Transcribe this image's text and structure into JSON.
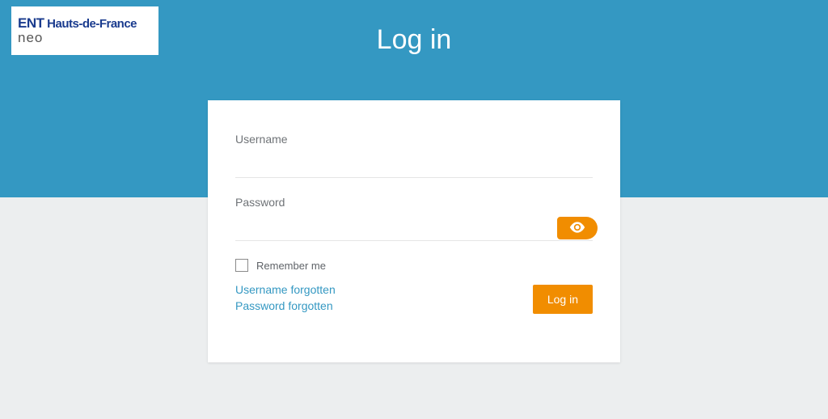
{
  "logo": {
    "line1_strong": "ENT",
    "line1_rest": " Hauts-de-France",
    "line2": "neo"
  },
  "title": "Log in",
  "form": {
    "username_label": "Username",
    "username_value": "",
    "password_label": "Password",
    "password_value": "",
    "remember_label": "Remember me",
    "forgot_username": "Username forgotten",
    "forgot_password": "Password forgotten",
    "submit_label": "Log in"
  },
  "colors": {
    "brand_blue": "#3498c2",
    "accent_orange": "#f18d00"
  }
}
